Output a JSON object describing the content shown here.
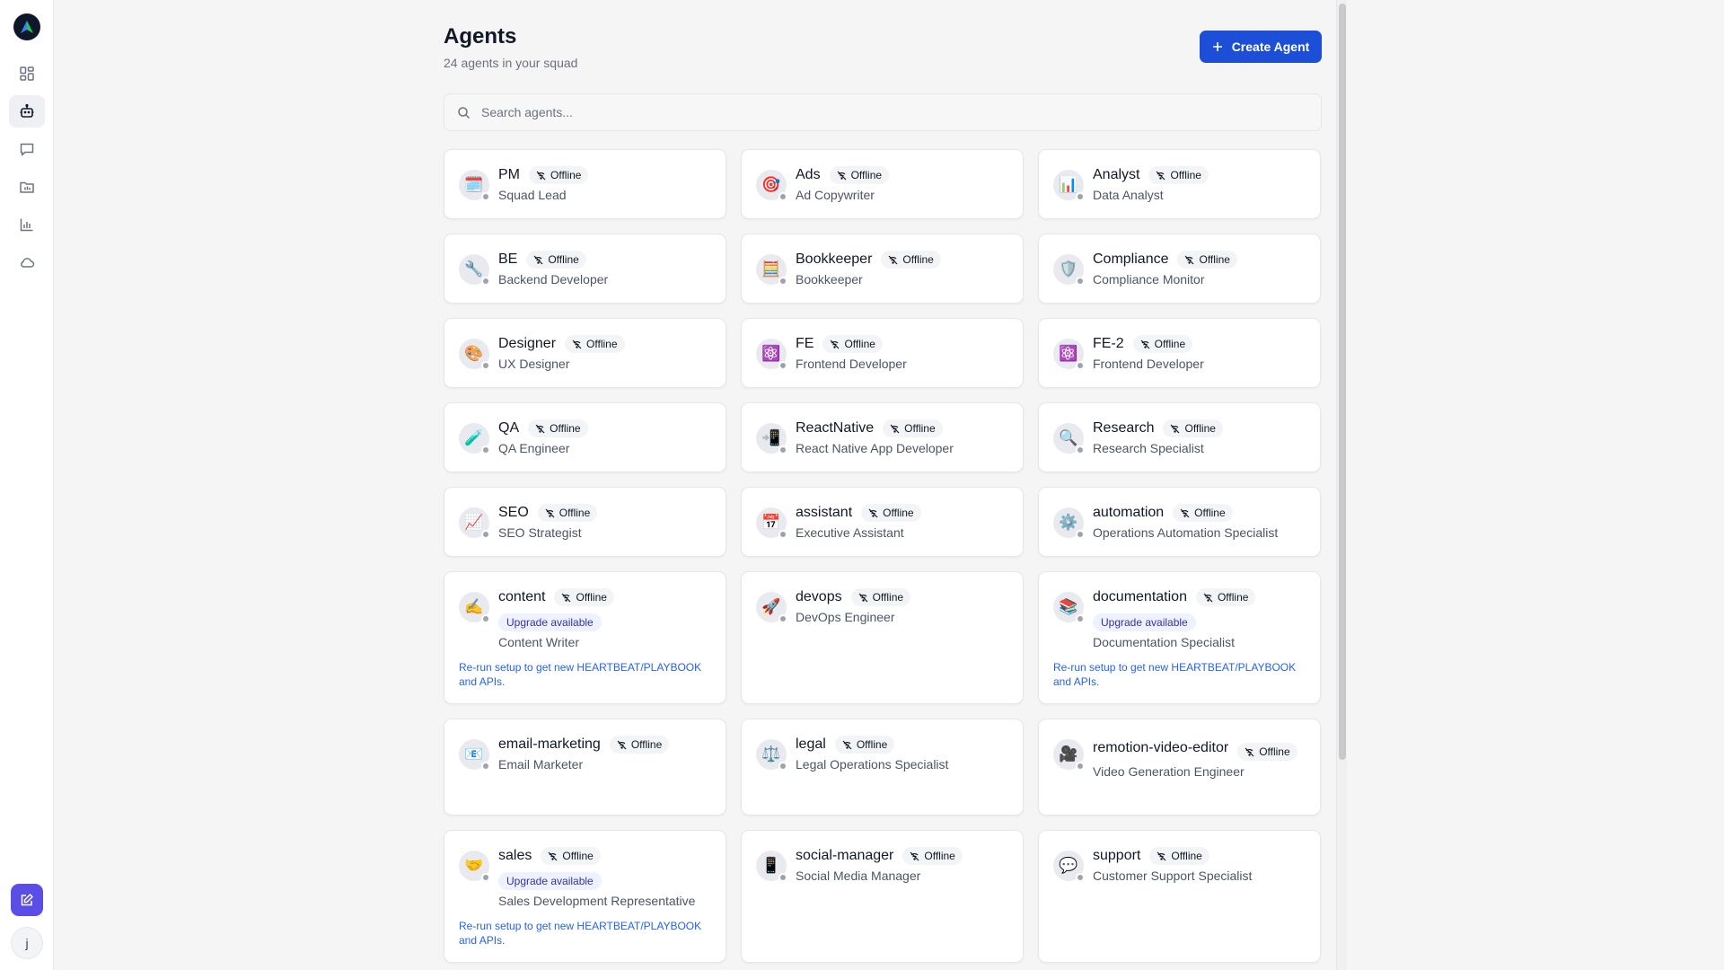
{
  "header": {
    "title": "Agents",
    "subtitle": "24 agents in your squad",
    "create_label": "Create Agent"
  },
  "search": {
    "placeholder": "Search agents..."
  },
  "user": {
    "initial": "j"
  },
  "colors": {
    "accent": "#1d4ed8",
    "edit": "#5b4ee6",
    "link": "#2563eb",
    "offline_dot": "#9ca3af"
  },
  "agents": [
    {
      "name": "PM",
      "status": "Offline",
      "role": "Squad Lead",
      "icon": "🗓️"
    },
    {
      "name": "Ads",
      "status": "Offline",
      "role": "Ad Copywriter",
      "icon": "🎯"
    },
    {
      "name": "Analyst",
      "status": "Offline",
      "role": "Data Analyst",
      "icon": "📊"
    },
    {
      "name": "BE",
      "status": "Offline",
      "role": "Backend Developer",
      "icon": "🔧"
    },
    {
      "name": "Bookkeeper",
      "status": "Offline",
      "role": "Bookkeeper",
      "icon": "🧮"
    },
    {
      "name": "Compliance",
      "status": "Offline",
      "role": "Compliance Monitor",
      "icon": "🛡️"
    },
    {
      "name": "Designer",
      "status": "Offline",
      "role": "UX Designer",
      "icon": "🎨"
    },
    {
      "name": "FE",
      "status": "Offline",
      "role": "Frontend Developer",
      "icon": "⚛️"
    },
    {
      "name": "FE-2",
      "status": "Offline",
      "role": "Frontend Developer",
      "icon": "⚛️"
    },
    {
      "name": "QA",
      "status": "Offline",
      "role": "QA Engineer",
      "icon": "🧪"
    },
    {
      "name": "ReactNative",
      "status": "Offline",
      "role": "React Native App Developer",
      "icon": "📲"
    },
    {
      "name": "Research",
      "status": "Offline",
      "role": "Research Specialist",
      "icon": "🔍"
    },
    {
      "name": "SEO",
      "status": "Offline",
      "role": "SEO Strategist",
      "icon": "📈"
    },
    {
      "name": "assistant",
      "status": "Offline",
      "role": "Executive Assistant",
      "icon": "📅"
    },
    {
      "name": "automation",
      "status": "Offline",
      "role": "Operations Automation Specialist",
      "icon": "⚙️"
    },
    {
      "name": "content",
      "status": "Offline",
      "role": "Content Writer",
      "icon": "✍️",
      "upgrade": "Upgrade available",
      "note": "Re-run setup to get new HEARTBEAT/PLAYBOOK and APIs."
    },
    {
      "name": "devops",
      "status": "Offline",
      "role": "DevOps Engineer",
      "icon": "🚀"
    },
    {
      "name": "documentation",
      "status": "Offline",
      "role": "Documentation Specialist",
      "icon": "📚",
      "upgrade": "Upgrade available",
      "note": "Re-run setup to get new HEARTBEAT/PLAYBOOK and APIs."
    },
    {
      "name": "email-marketing",
      "status": "Offline",
      "role": "Email Marketer",
      "icon": "📧"
    },
    {
      "name": "legal",
      "status": "Offline",
      "role": "Legal Operations Specialist",
      "icon": "⚖️"
    },
    {
      "name": "remotion-video-editor",
      "status": "Offline",
      "role": "Video Generation Engineer",
      "icon": "🎥",
      "wrap": true
    },
    {
      "name": "sales",
      "status": "Offline",
      "role": "Sales Development Representative",
      "icon": "🤝",
      "upgrade": "Upgrade available",
      "note": "Re-run setup to get new HEARTBEAT/PLAYBOOK and APIs."
    },
    {
      "name": "social-manager",
      "status": "Offline",
      "role": "Social Media Manager",
      "icon": "📱"
    },
    {
      "name": "support",
      "status": "Offline",
      "role": "Customer Support Specialist",
      "icon": "💬"
    }
  ]
}
